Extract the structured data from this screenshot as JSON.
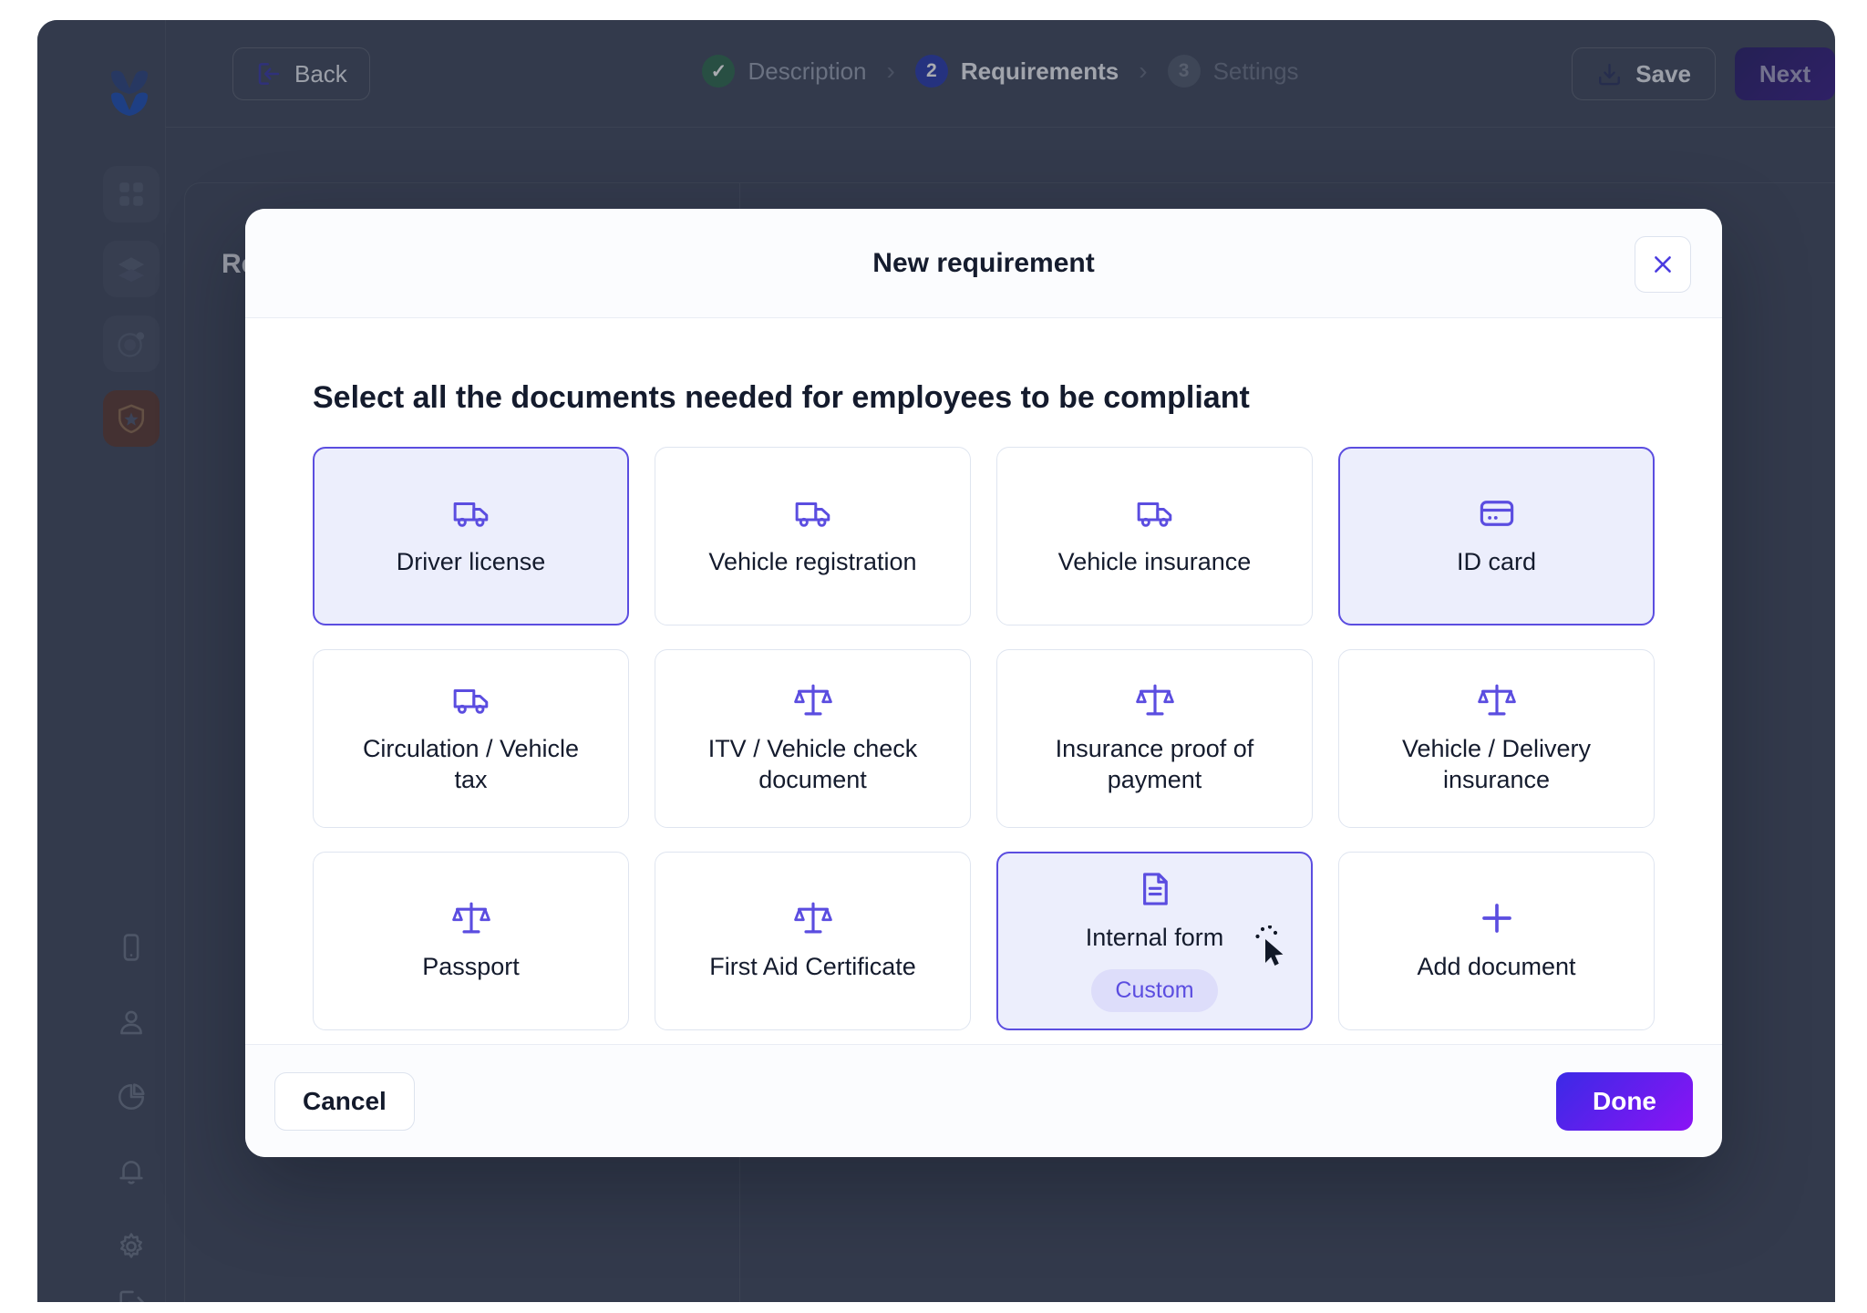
{
  "app": {
    "brand": "logo-mark",
    "sidebar": {
      "tiles": [
        {
          "name": "dashboard",
          "icon": "grid-icon",
          "active": false
        },
        {
          "name": "layers",
          "icon": "layers-icon",
          "active": false
        },
        {
          "name": "radar",
          "icon": "radar-icon",
          "active": false
        },
        {
          "name": "compliance",
          "icon": "shield-star-icon",
          "active": true
        }
      ],
      "bottom_items": [
        {
          "name": "mobile",
          "icon": "mobile-icon"
        },
        {
          "name": "profile",
          "icon": "user-icon"
        },
        {
          "name": "analytics",
          "icon": "pie-chart-icon"
        },
        {
          "name": "notifications",
          "icon": "bell-icon"
        },
        {
          "name": "settings",
          "icon": "gear-icon"
        },
        {
          "name": "logout",
          "icon": "logout-icon"
        }
      ]
    },
    "topbar": {
      "back_label": "Back",
      "back_icon": "back-arrow-icon",
      "save_label": "Save",
      "save_icon": "save-icon",
      "next_label": "Next",
      "separator": "›",
      "steps": [
        {
          "badge": "✓",
          "label": "Description",
          "state": "done"
        },
        {
          "badge": "2",
          "label": "Requirements",
          "state": "current"
        },
        {
          "badge": "3",
          "label": "Settings",
          "state": "todo"
        }
      ]
    },
    "background": {
      "panel_title": "Re"
    }
  },
  "modal": {
    "title": "New requirement",
    "close_icon": "close-icon",
    "heading": "Select all the documents needed for employees to be compliant",
    "documents": [
      {
        "label": "Driver license",
        "icon": "truck-icon",
        "selected": true,
        "badge": null
      },
      {
        "label": "Vehicle registration",
        "icon": "truck-icon",
        "selected": false,
        "badge": null
      },
      {
        "label": "Vehicle insurance",
        "icon": "truck-icon",
        "selected": false,
        "badge": null
      },
      {
        "label": "ID card",
        "icon": "id-card-icon",
        "selected": true,
        "badge": null
      },
      {
        "label": "Circulation / Vehicle tax",
        "icon": "truck-icon",
        "selected": false,
        "badge": null
      },
      {
        "label": "ITV / Vehicle check document",
        "icon": "scales-icon",
        "selected": false,
        "badge": null
      },
      {
        "label": "Insurance proof of payment",
        "icon": "scales-icon",
        "selected": false,
        "badge": null
      },
      {
        "label": "Vehicle / Delivery insurance",
        "icon": "scales-icon",
        "selected": false,
        "badge": null
      },
      {
        "label": "Passport",
        "icon": "scales-icon",
        "selected": false,
        "badge": null
      },
      {
        "label": "First Aid Certificate",
        "icon": "scales-icon",
        "selected": false,
        "badge": null
      },
      {
        "label": "Internal form",
        "icon": "document-icon",
        "selected": true,
        "badge": "Custom"
      },
      {
        "label": "Add document",
        "icon": "plus-icon",
        "selected": false,
        "badge": null
      }
    ],
    "cancel_label": "Cancel",
    "done_label": "Done"
  },
  "colors": {
    "app_background": "#414a5e",
    "accent_purple": "#5b4de0",
    "selected_card_bg": "#eceefc",
    "done_gradient_start": "#3b2ae6",
    "done_gradient_end": "#8b13f5",
    "step_done_green": "#2f6b4f",
    "step_current_blue": "#2b3cb0",
    "compliance_tile": "#5d3a34"
  }
}
